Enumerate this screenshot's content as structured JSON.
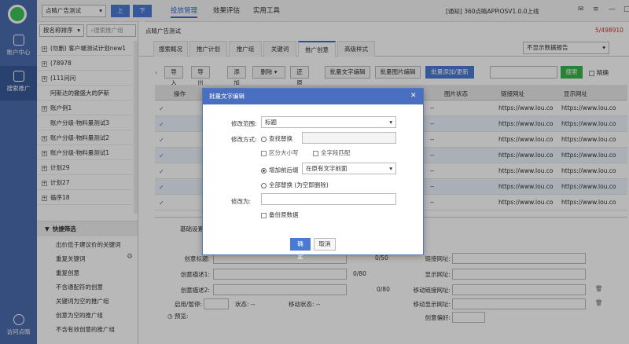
{
  "nav": {
    "account_center": "账户中心",
    "search_promo": "搜索推广",
    "visit_tool": "访问点睛"
  },
  "topbar": {
    "account_select": "点睛广告测试",
    "upload": "上传",
    "download": "下载",
    "menus": [
      "投放管理",
      "效果评估",
      "实用工具"
    ],
    "notice": "[通知] 360点睛APPiOSV1.0.0上线"
  },
  "sidebar": {
    "sort_select": "按名称排序",
    "search_placeholder": "搜索推广组",
    "items": [
      "(勿删) 客户端测试计划new1",
      "(78978",
      "(111问问",
      "阿斯达的撒盛大的萨斯",
      "账户例1",
      "账户分级-物料量测试3",
      "账户分级-物料量测试2",
      "账户分级-物料量测试1",
      "计划29",
      "计划27",
      "循序18"
    ],
    "quick_title": "快捷筛选",
    "quick_items": [
      "出价低于建议价的关键词",
      "重复关键词",
      "重复创意",
      "不含通配符的创意",
      "关键词为空的推广组",
      "创意为空的推广组",
      "不含有效创意的推广组"
    ]
  },
  "main": {
    "breadcrumb": "点睛广告测试",
    "count": "5/498910",
    "tabs": [
      "搜索概况",
      "推广计划",
      "推广组",
      "关键词",
      "推广创意",
      "高级样式"
    ],
    "report_select": "不显示数据报告",
    "toolbar": {
      "import": "导入",
      "export": "导出",
      "add": "添加",
      "delete": "删除",
      "restore": "还原",
      "batch_text": "批量文字编辑",
      "batch_img": "批量图片编辑",
      "batch_add": "批量添加/更新",
      "search": "搜索",
      "precise": "精确"
    },
    "columns": {
      "op": "操作",
      "img_status": "图片状态",
      "link_url": "链接网址",
      "display_url": "显示网址"
    },
    "row_dash": "--",
    "row_link": "https://www.lou.co",
    "row_disp": "https://www.lou.co",
    "detail": {
      "basic_tab": "基础设置",
      "title_label": "创意标题:",
      "desc1_label": "创意描述1:",
      "desc2_label": "创意描述2:",
      "pause_label": "启用/暂停:",
      "status_label": "状态: --",
      "mobile_status_label": "移动状态: --",
      "preview_label": "预览:",
      "counter1": "0/80",
      "counter2": "0/80",
      "counter0": "0/50",
      "link_label": "链接网址:",
      "display_label": "显示网址:",
      "mlink_label": "移动链接网址:",
      "mdisplay_label": "移动显示网址:",
      "pref_label": "创意偏好:"
    }
  },
  "dialog": {
    "title": "批量文字编辑",
    "scope_label": "修改范围:",
    "scope_value": "标题",
    "mode_label": "修改方式:",
    "find_replace": "查找替换",
    "case_sensitive": "区分大小写",
    "full_match": "全字段匹配",
    "add_prefix_suffix": "增加前后缀",
    "position_value": "在原有文字前面",
    "replace_all": "全部替换",
    "replace_all_note": "(为空即删除)",
    "modify_to_label": "修改为:",
    "backup": "备份原数据",
    "ok": "确定",
    "cancel": "取消"
  }
}
